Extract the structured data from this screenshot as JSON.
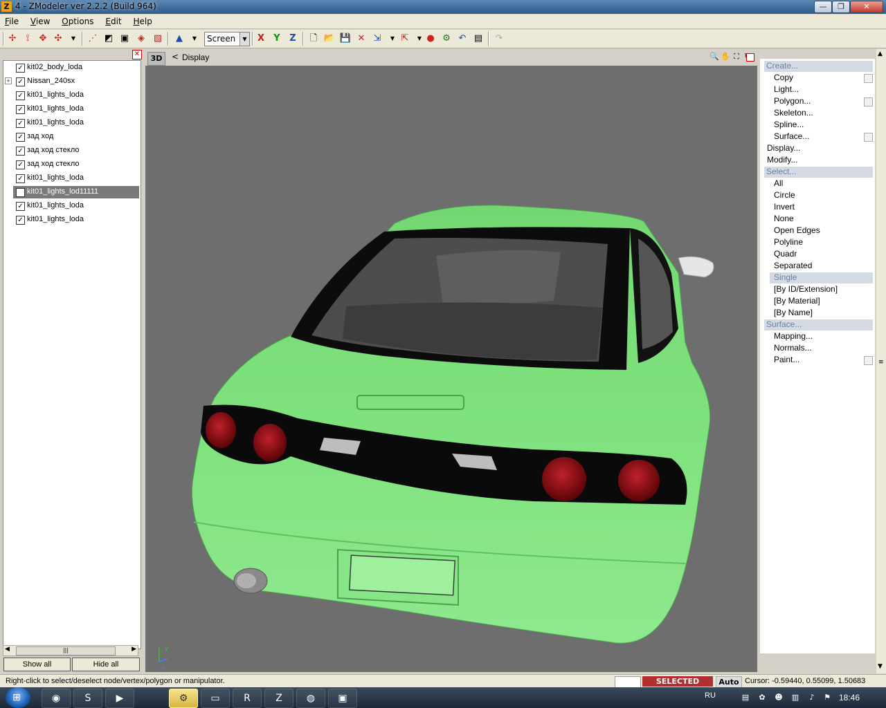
{
  "window": {
    "title": "4 - ZModeler ver 2.2.2 (Build 964)",
    "app_icon": "Z",
    "min_glyph": "—",
    "max_glyph": "❐",
    "close_glyph": "✕"
  },
  "menu": [
    "File",
    "View",
    "Options",
    "Edit",
    "Help"
  ],
  "toolbar": {
    "space_value": "Screen",
    "axis_x": "X",
    "axis_y": "Y",
    "axis_z": "Z"
  },
  "tree": {
    "close_glyph": "✕",
    "items": [
      {
        "label": "kit02_body_loda",
        "checked": true,
        "expander": false
      },
      {
        "label": "Nissan_240sx",
        "checked": true,
        "expander": true
      },
      {
        "label": "kit01_lights_loda",
        "checked": true,
        "expander": false
      },
      {
        "label": "kit01_lights_loda",
        "checked": true,
        "expander": false
      },
      {
        "label": "kit01_lights_loda",
        "checked": true,
        "expander": false
      },
      {
        "label": "зад ход",
        "checked": true,
        "expander": false
      },
      {
        "label": "зад ход стекло",
        "checked": true,
        "expander": false
      },
      {
        "label": "зад ход стекло",
        "checked": true,
        "expander": false
      },
      {
        "label": "kit01_lights_loda",
        "checked": true,
        "expander": false
      },
      {
        "label": "kit01_lights_lod11111",
        "checked": false,
        "expander": false,
        "selected": true
      },
      {
        "label": "kit01_lights_loda",
        "checked": true,
        "expander": false
      },
      {
        "label": "kit01_lights_loda",
        "checked": true,
        "expander": false
      }
    ],
    "show_all": "Show all",
    "hide_all": "Hide all"
  },
  "viewport": {
    "tab": "3D",
    "arrow": "<",
    "label": "Display",
    "axis_y": "y",
    "axis_z": "z"
  },
  "command_panel": {
    "close_glyph": "✕",
    "items": [
      {
        "label": "Create...",
        "kind": "header"
      },
      {
        "label": "Copy",
        "kind": "sub",
        "box": true
      },
      {
        "label": "Light...",
        "kind": "sub"
      },
      {
        "label": "Polygon...",
        "kind": "sub",
        "box": true
      },
      {
        "label": "Skeleton...",
        "kind": "sub"
      },
      {
        "label": "Spline...",
        "kind": "sub"
      },
      {
        "label": "Surface...",
        "kind": "sub",
        "box": true
      },
      {
        "label": "Display...",
        "kind": "top"
      },
      {
        "label": "Modify...",
        "kind": "top"
      },
      {
        "label": "Select...",
        "kind": "header"
      },
      {
        "label": "All",
        "kind": "sub"
      },
      {
        "label": "Circle",
        "kind": "sub"
      },
      {
        "label": "Invert",
        "kind": "sub"
      },
      {
        "label": "None",
        "kind": "sub"
      },
      {
        "label": "Open Edges",
        "kind": "sub"
      },
      {
        "label": "Polyline",
        "kind": "sub"
      },
      {
        "label": "Quadr",
        "kind": "sub"
      },
      {
        "label": "Separated",
        "kind": "sub"
      },
      {
        "label": "Single",
        "kind": "active"
      },
      {
        "label": "[By ID/Extension]",
        "kind": "sub"
      },
      {
        "label": "[By Material]",
        "kind": "sub"
      },
      {
        "label": "[By Name]",
        "kind": "sub"
      },
      {
        "label": "Surface...",
        "kind": "header"
      },
      {
        "label": "Mapping...",
        "kind": "sub"
      },
      {
        "label": "Normals...",
        "kind": "sub"
      },
      {
        "label": "Paint...",
        "kind": "sub",
        "box": true
      }
    ]
  },
  "status": {
    "hint": "Right-click to select/deselect node/vertex/polygon or manipulator.",
    "mode": "SELECTED MODE",
    "auto": "Auto",
    "cursor": "Cursor: -0.59440, 0.55099, 1.50683"
  },
  "taskbar": {
    "lang": "RU",
    "clock": "18:46"
  },
  "colors": {
    "car_body": "#7be07a",
    "taillight": "#8b0a10",
    "viewport_bg": "#6e6e6e",
    "selected_mode": "#b03030"
  }
}
